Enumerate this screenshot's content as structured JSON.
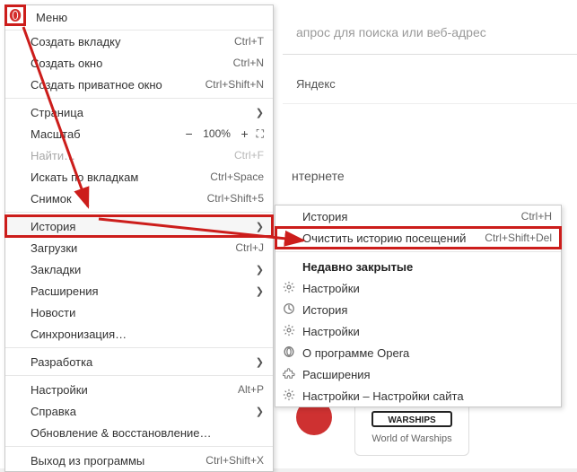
{
  "background": {
    "address_placeholder": "апрос для поиска или веб-адрес",
    "yandex_label": "Яндекс",
    "internet_label": "нтернете",
    "tile_caption": "World of Warships",
    "tile_logo_text": "WARSHIPS"
  },
  "menu": {
    "title": "Меню",
    "items": {
      "new_tab": {
        "label": "Создать вкладку",
        "shortcut": "Ctrl+T"
      },
      "new_window": {
        "label": "Создать окно",
        "shortcut": "Ctrl+N"
      },
      "new_private": {
        "label": "Создать приватное окно",
        "shortcut": "Ctrl+Shift+N"
      },
      "page": {
        "label": "Страница"
      },
      "zoom": {
        "label": "Масштаб",
        "minus": "−",
        "pct": "100%",
        "plus": "+",
        "full": "⛶"
      },
      "find": {
        "label": "Найти…",
        "shortcut": "Ctrl+F"
      },
      "search_tabs": {
        "label": "Искать по вкладкам",
        "shortcut": "Ctrl+Space"
      },
      "snapshot": {
        "label": "Снимок",
        "shortcut": "Ctrl+Shift+5"
      },
      "history": {
        "label": "История"
      },
      "downloads": {
        "label": "Загрузки",
        "shortcut": "Ctrl+J"
      },
      "bookmarks": {
        "label": "Закладки"
      },
      "extensions": {
        "label": "Расширения"
      },
      "news": {
        "label": "Новости"
      },
      "sync": {
        "label": "Синхронизация…"
      },
      "dev": {
        "label": "Разработка"
      },
      "settings": {
        "label": "Настройки",
        "shortcut": "Alt+P"
      },
      "help": {
        "label": "Справка"
      },
      "update": {
        "label": "Обновление & восстановление…"
      },
      "exit": {
        "label": "Выход из программы",
        "shortcut": "Ctrl+Shift+X"
      }
    }
  },
  "submenu": {
    "history": {
      "label": "История",
      "shortcut": "Ctrl+H"
    },
    "clear": {
      "label": "Очистить историю посещений",
      "shortcut": "Ctrl+Shift+Del"
    },
    "recent_header": "Недавно закрытые",
    "recent": [
      {
        "label": "Настройки",
        "icon": "gear"
      },
      {
        "label": "История",
        "icon": "clock"
      },
      {
        "label": "Настройки",
        "icon": "gear"
      },
      {
        "label": "О программе Opera",
        "icon": "opera"
      },
      {
        "label": "Расширения",
        "icon": "puzzle"
      },
      {
        "label": "Настройки – Настройки сайта",
        "icon": "gear"
      }
    ]
  }
}
